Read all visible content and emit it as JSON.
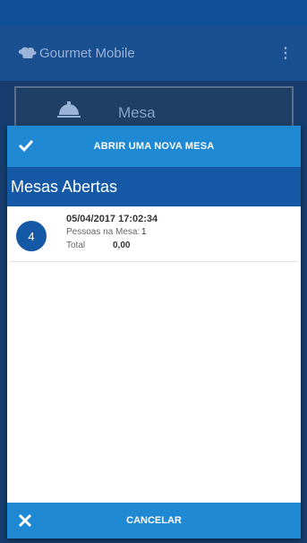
{
  "appbar": {
    "title": "Gourmet Mobile",
    "more_icon": "more-vertical-icon",
    "logo_icon": "chef-hat-icon"
  },
  "background": {
    "card_label": "Mesa",
    "card_icon": "cloche-icon"
  },
  "dialog": {
    "open_button_label": "ABRIR UMA NOVA MESA",
    "open_icon": "check-icon",
    "section_title": "Mesas Abertas",
    "items": [
      {
        "number": "4",
        "datetime": "05/04/2017 17:02:34",
        "people_label": "Pessoas na Mesa:",
        "people_value": "1",
        "total_label": "Total",
        "total_value": "0,00"
      }
    ],
    "cancel_button_label": "CANCELAR",
    "cancel_icon": "close-icon"
  },
  "colors": {
    "primary": "#1558a6",
    "button": "#1f89d4",
    "statusbar": "#0f4f97"
  }
}
